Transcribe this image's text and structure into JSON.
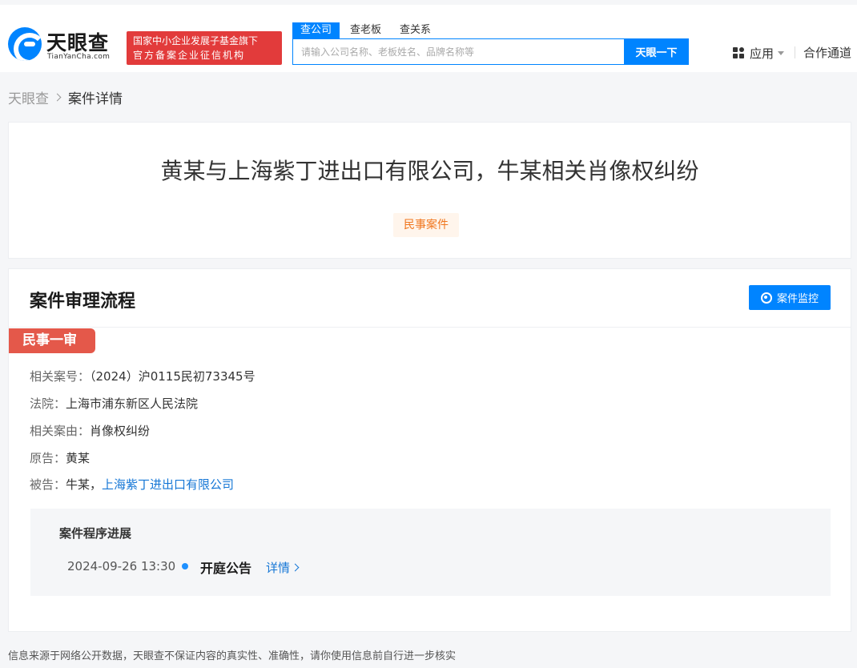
{
  "header": {
    "logo_text": "天眼查",
    "logo_sub": "TianYanCha.com",
    "badge_line1": "国家中小企业发展子基金旗下",
    "badge_line2": "官方备案企业征信机构",
    "search_tabs": [
      "查公司",
      "查老板",
      "查关系"
    ],
    "search_placeholder": "请输入公司名称、老板姓名、品牌名称等",
    "search_button": "天眼一下",
    "nav_apps": "应用",
    "nav_partner": "合作通道"
  },
  "breadcrumb": {
    "home": "天眼查",
    "current": "案件详情"
  },
  "case": {
    "title": "黄某与上海紫丁进出口有限公司，牛某相关肖像权纠纷",
    "tag": "民事案件"
  },
  "process": {
    "title": "案件审理流程",
    "monitor_button": "案件监控",
    "stage": "民事一审",
    "case_no_label": "相关案号：",
    "case_no": "（2024）沪0115民初73345号",
    "court_label": "法院：",
    "court": "上海市浦东新区人民法院",
    "cause_label": "相关案由：",
    "cause": "肖像权纠纷",
    "plaintiff_label": "原告：",
    "plaintiff": "黄某",
    "defendant_label": "被告：",
    "defendant_person": "牛某，",
    "defendant_company": "上海紫丁进出口有限公司",
    "progress_title": "案件程序进展",
    "progress_time": "2024-09-26 13:30",
    "progress_event": "开庭公告",
    "progress_detail": "详情"
  },
  "footer": {
    "note": "信息来源于网络公开数据，天眼查不保证内容的真实性、准确性，请你使用信息前自行进一步核实"
  },
  "colors": {
    "brand": "#0084ff",
    "stage": "#e4584a",
    "tag_text": "#f0761e",
    "link": "#1677d6"
  }
}
